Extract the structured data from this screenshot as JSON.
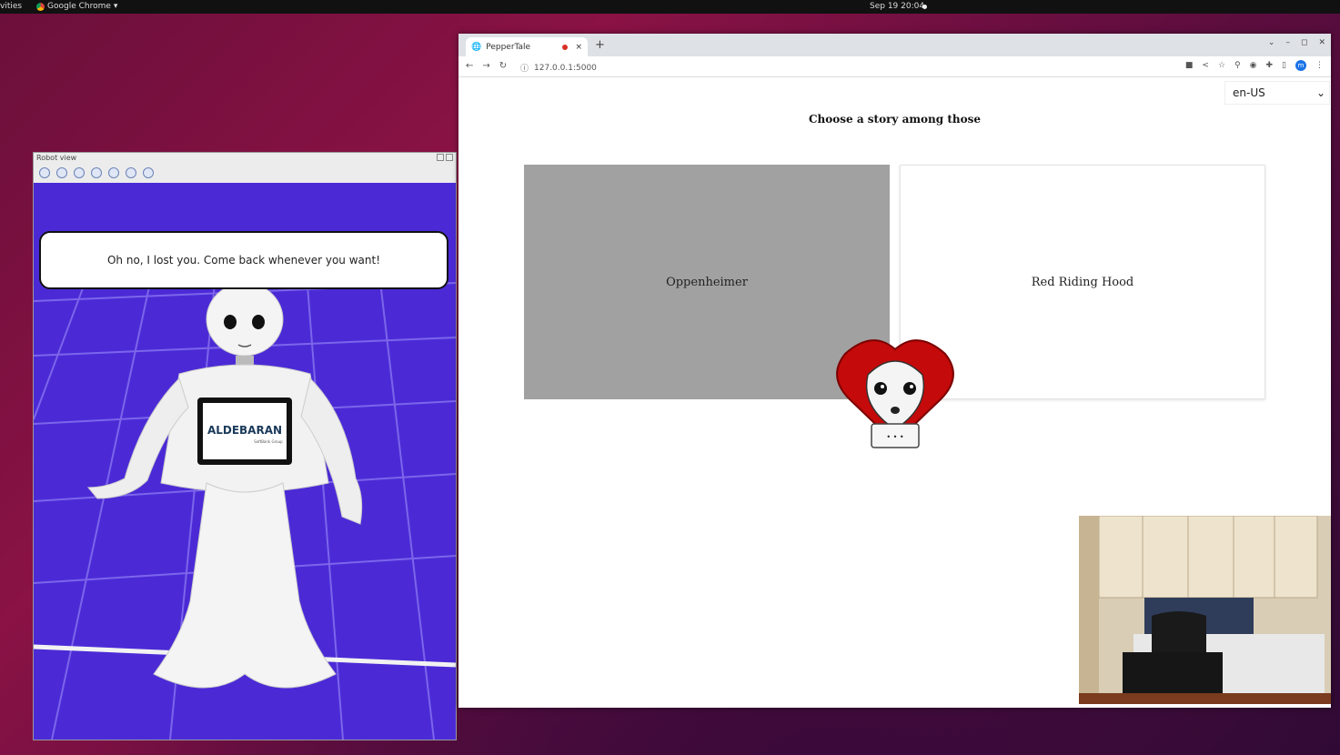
{
  "topbar": {
    "activities": "vities",
    "app_name": "Google Chrome",
    "clock": "Sep 19  20:04"
  },
  "robot_view": {
    "title": "Robot view",
    "speech": "Oh no, I lost you. Come back whenever you want!",
    "tablet_brand": "ALDEBARAN",
    "tablet_sub": "SoftBank Group"
  },
  "browser": {
    "tab_title": "PepperTale",
    "url": "127.0.0.1:5000",
    "new_tab": "+",
    "close_tab": "×"
  },
  "page": {
    "language": "en-US",
    "heading": "Choose a story among those",
    "stories": [
      "Oppenheimer",
      "Red Riding Hood"
    ],
    "mascot_dots": "• • •"
  },
  "colors": {
    "scene_bg": "#4b2ad6",
    "selected_card": "#a1a1a1",
    "mascot_red": "#c40a0a"
  }
}
